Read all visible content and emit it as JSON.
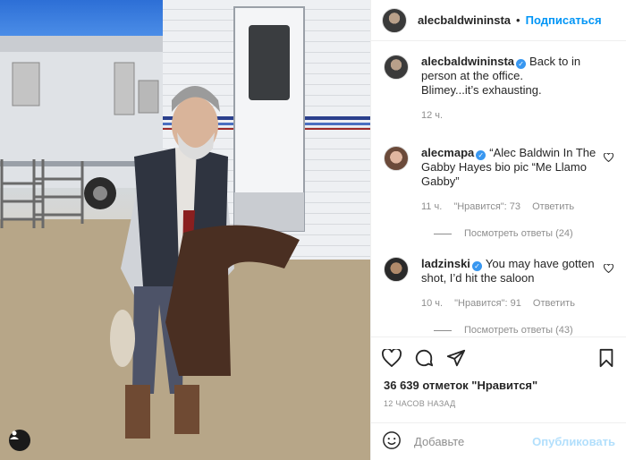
{
  "post": {
    "author": "alecbaldwininsta",
    "follow_label": "Подписаться",
    "caption_lines": [
      "Back to in person at the office.",
      "Blimey...it’s exhausting."
    ],
    "caption_time": "12 ч.",
    "likes": "36 639 отметок \"Нравится\"",
    "posted": "12 ЧАСОВ НАЗАД"
  },
  "comments": [
    {
      "user": "alecmapa",
      "text": "“Alec Baldwin In The Gabby Hayes bio pic “Me Llamo Gabby”",
      "time": "11 ч.",
      "likes": "\"Нравится\": 73",
      "reply_label": "Ответить",
      "view_replies": "Посмотреть ответы (24)"
    },
    {
      "user": "ladzinski",
      "text": "You may have gotten shot, I’d hit the saloon",
      "time": "10 ч.",
      "likes": "\"Нравится\": 91",
      "reply_label": "Ответить",
      "view_replies": "Посмотреть ответы (43)"
    }
  ],
  "composer": {
    "placeholder": "Добавьте",
    "post_label": "Опубликовать"
  },
  "icons": {
    "like": "heart-icon",
    "comment": "comment-icon",
    "share": "send-icon",
    "save": "bookmark-icon",
    "emoji": "emoji-icon",
    "tags": "user-tag-icon"
  },
  "colors": {
    "accent": "#0095f6",
    "verified": "#3897f0",
    "muted": "#8e8e8e"
  }
}
